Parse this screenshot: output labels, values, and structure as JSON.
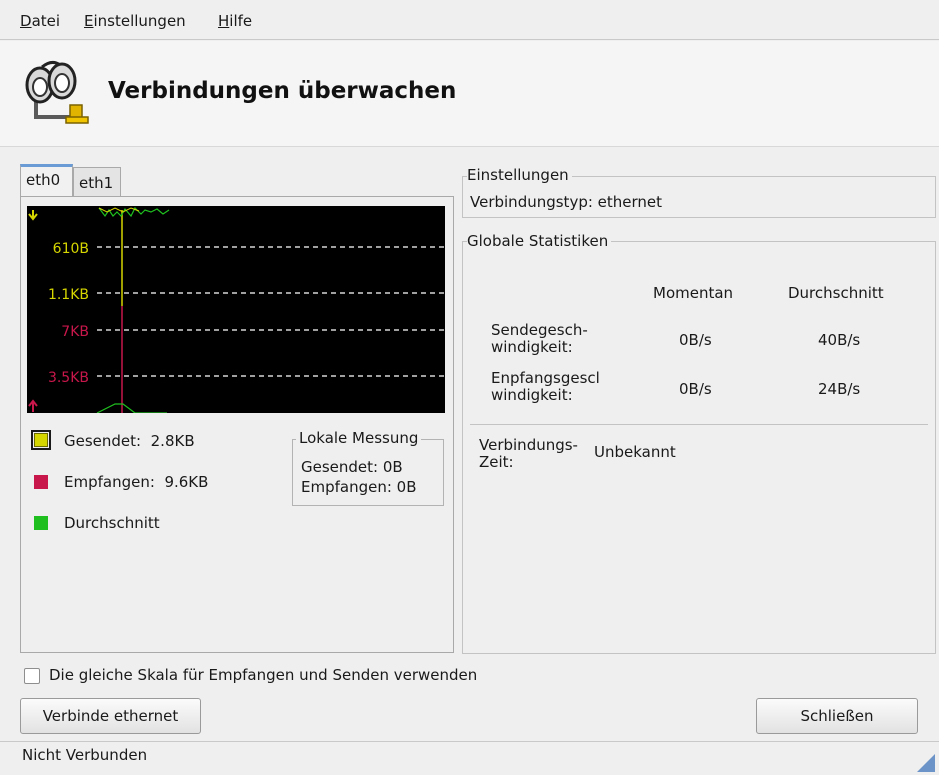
{
  "menu": {
    "items": [
      {
        "label": "Datei",
        "accel": "D",
        "rest": "atei"
      },
      {
        "label": "Einstellungen",
        "accel": "E",
        "rest": "instellungen"
      },
      {
        "label": "Hilfe",
        "accel": "H",
        "rest": "ilfe"
      }
    ]
  },
  "header": {
    "title": "Verbindungen überwachen",
    "icon": "binoculars-network-icon"
  },
  "tabs": [
    "eth0",
    "eth1"
  ],
  "graph": {
    "labels": [
      {
        "text": "610B",
        "color": "#d6d600"
      },
      {
        "text": "1.1KB",
        "color": "#d6d600"
      },
      {
        "text": "7KB",
        "color": "#c8174b"
      },
      {
        "text": "3.5KB",
        "color": "#c8174b"
      }
    ],
    "colors": {
      "sent": "#d6d600",
      "received": "#c8174b",
      "average": "#1fbf1f"
    }
  },
  "legend": {
    "sent": {
      "label": "Gesendet:",
      "value": "2.8KB",
      "color": "#d6d600"
    },
    "received": {
      "label": "Empfangen:",
      "value": "9.6KB",
      "color": "#c8174b"
    },
    "average": {
      "label": "Durchschnitt",
      "color": "#1fbf1f"
    }
  },
  "local_measure": {
    "title": "Lokale Messung",
    "sent": "Gesendet: 0B",
    "received": "Empfangen: 0B"
  },
  "settings": {
    "title": "Einstellungen",
    "connection_type": "Verbindungstyp: ethernet"
  },
  "global_stats": {
    "title": "Globale Statistiken",
    "col_current": "Momentan",
    "col_average": "Durchschnitt",
    "rows": [
      {
        "label_line1": "Sendegesch-",
        "label_line2": "windigkeit:",
        "current": "0B/s",
        "average": "40B/s"
      },
      {
        "label_line1": "Enpfangsgescl",
        "label_line2": "windigkeit:",
        "current": "0B/s",
        "average": "24B/s"
      }
    ],
    "conn_time_label_line1": "Verbindungs-",
    "conn_time_label_line2": "Zeit:",
    "conn_time_value": "Unbekannt"
  },
  "checkbox_label": "Die gleiche Skala für Empfangen und Senden verwenden",
  "buttons": {
    "connect": "Verbinde ethernet",
    "close": "Schließen"
  },
  "status": "Nicht Verbunden"
}
